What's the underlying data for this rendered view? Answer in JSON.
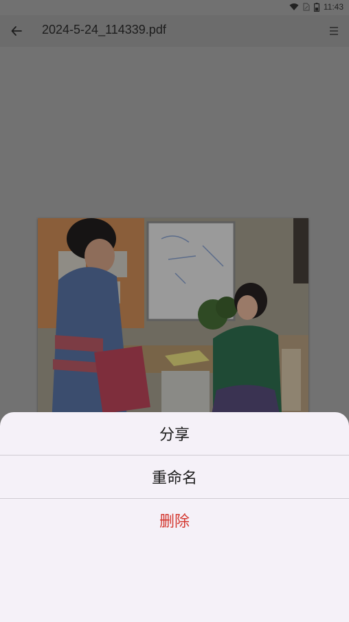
{
  "status_bar": {
    "time": "11:43",
    "icons": [
      "wifi-icon",
      "sim-icon",
      "battery-icon"
    ]
  },
  "app_bar": {
    "title": "2024-5-24_114339.pdf",
    "back_icon": "arrow-left-icon",
    "menu_icon": "menu-lines-icon"
  },
  "document": {
    "page_image": "office-photo"
  },
  "sheet": {
    "items": [
      {
        "label": "分享"
      },
      {
        "label": "重命名"
      },
      {
        "label": "删除"
      }
    ],
    "danger_color": "#d3362e"
  }
}
